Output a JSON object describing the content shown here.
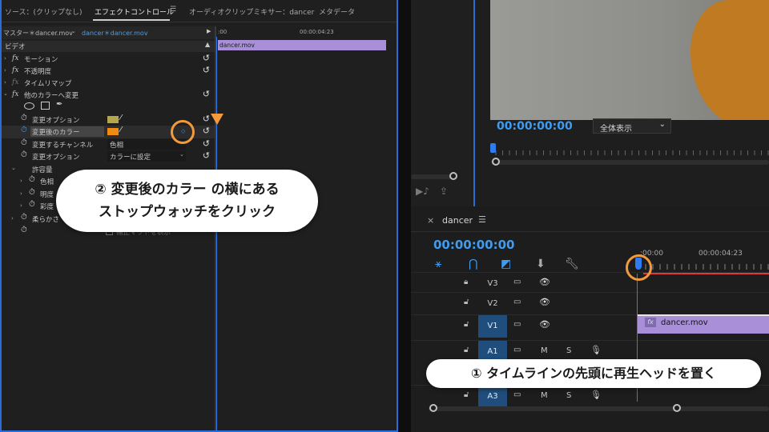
{
  "effect_panel": {
    "tabs": [
      "ソース：(クリップなし)",
      "エフェクトコントロール",
      "オーディオクリップミキサー：dancer",
      "メタデータ"
    ],
    "menu_icon": "☰",
    "master_label": "マスター＊dancer.mov",
    "sequence_label": "dancer＊dancer.mov",
    "mini_timecodes": [
      ":00",
      "00:00:04:23"
    ],
    "clip_name": "dancer.mov",
    "section_video": "ビデオ",
    "rows": {
      "motion": "モーション",
      "opacity": "不透明度",
      "time_remap": "タイムリマップ",
      "change_color": "他のカラーへ変更",
      "change_option": "変更オプション",
      "changed_color": "変更後のカラー",
      "channel": "変更するチャンネル",
      "channel_value": "色相",
      "option2": "変更オプション",
      "option2_value": "カラーに設定",
      "tolerance": "許容量",
      "hue": "色相",
      "lightness": "明度",
      "saturation": "彩度",
      "softness": "柔らかさ",
      "invert": "補正マットを表示"
    },
    "colors": {
      "swatch_option": "#b7a54a",
      "swatch_changed": "#ef8a13"
    }
  },
  "callout_2": {
    "line1": "② 変更後のカラー の横にある",
    "line2": "ストップウォッチをクリック"
  },
  "callout_1": {
    "text": "① タイムラインの先頭に再生ヘッドを置く"
  },
  "program": {
    "timecode": "00:00:00:00",
    "zoom": "全体表示"
  },
  "timeline": {
    "tab_name": "dancer",
    "close": "×",
    "menu_icon": "☰",
    "timecode": "00:00:00:00",
    "ruler": [
      ":00:00",
      "00:00:04:23"
    ],
    "tracks": [
      {
        "name": "V3",
        "selected": false
      },
      {
        "name": "V2",
        "selected": false
      },
      {
        "name": "V1",
        "selected": true
      },
      {
        "name": "A1",
        "selected": true
      },
      {
        "name": "A3",
        "selected": true
      }
    ],
    "audio_m": "M",
    "audio_s": "S",
    "clip_name": "dancer.mov",
    "clip_fx": "fx"
  }
}
